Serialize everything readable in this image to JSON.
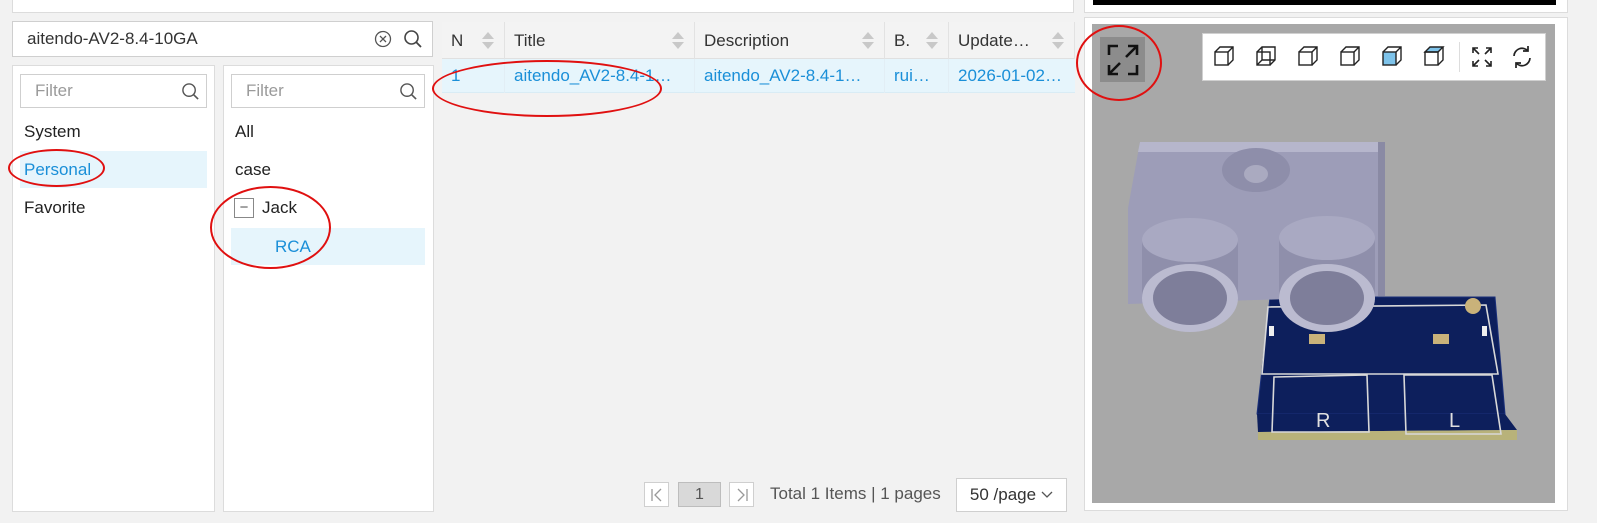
{
  "search": {
    "value": "aitendo-AV2-8.4-10GA"
  },
  "library_filter": {
    "placeholder": "Filter",
    "items": [
      "System",
      "Personal",
      "Favorite"
    ],
    "selected": "Personal"
  },
  "category_filter": {
    "placeholder": "Filter",
    "items": [
      "All",
      "case"
    ],
    "tree_node": "Jack",
    "tree_child": "RCA",
    "expand_symbol": "−"
  },
  "table": {
    "columns": [
      "N",
      "Title",
      "Description",
      "B.",
      "Update…"
    ],
    "rows": [
      {
        "n": "1",
        "title": "aitendo_AV2-8.4-1…",
        "description": "aitendo_AV2-8.4-1…",
        "b": "rui…",
        "updated": "2026-01-02…"
      }
    ]
  },
  "pagination": {
    "current": "1",
    "summary": "Total 1 Items | 1 pages",
    "page_size": "50 /page"
  },
  "viewer": {
    "board_labels": [
      "R",
      "L"
    ]
  },
  "colors": {
    "accent": "#1a8fd8",
    "selected_bg": "#e6f5fc",
    "annotation": "#e01010",
    "pcb": "#0d1f5c",
    "part": "#9d9db8"
  }
}
